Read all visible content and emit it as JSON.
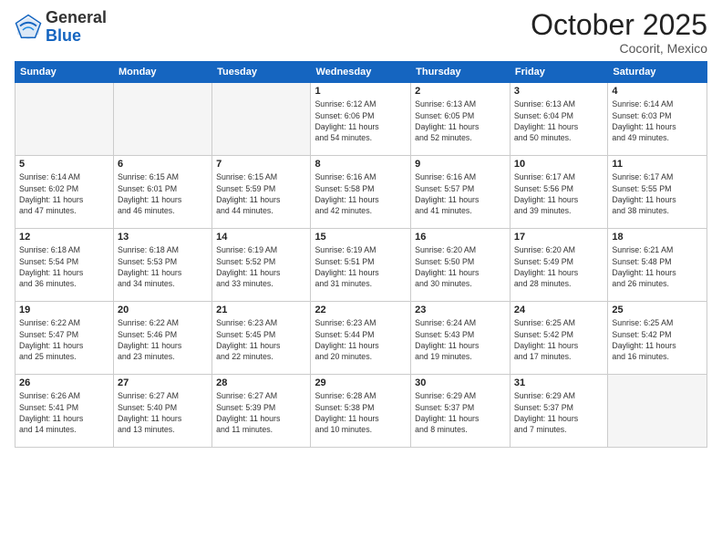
{
  "logo": {
    "general": "General",
    "blue": "Blue"
  },
  "header": {
    "month": "October 2025",
    "location": "Cocorit, Mexico"
  },
  "weekdays": [
    "Sunday",
    "Monday",
    "Tuesday",
    "Wednesday",
    "Thursday",
    "Friday",
    "Saturday"
  ],
  "weeks": [
    [
      {
        "day": "",
        "info": ""
      },
      {
        "day": "",
        "info": ""
      },
      {
        "day": "",
        "info": ""
      },
      {
        "day": "1",
        "info": "Sunrise: 6:12 AM\nSunset: 6:06 PM\nDaylight: 11 hours\nand 54 minutes."
      },
      {
        "day": "2",
        "info": "Sunrise: 6:13 AM\nSunset: 6:05 PM\nDaylight: 11 hours\nand 52 minutes."
      },
      {
        "day": "3",
        "info": "Sunrise: 6:13 AM\nSunset: 6:04 PM\nDaylight: 11 hours\nand 50 minutes."
      },
      {
        "day": "4",
        "info": "Sunrise: 6:14 AM\nSunset: 6:03 PM\nDaylight: 11 hours\nand 49 minutes."
      }
    ],
    [
      {
        "day": "5",
        "info": "Sunrise: 6:14 AM\nSunset: 6:02 PM\nDaylight: 11 hours\nand 47 minutes."
      },
      {
        "day": "6",
        "info": "Sunrise: 6:15 AM\nSunset: 6:01 PM\nDaylight: 11 hours\nand 46 minutes."
      },
      {
        "day": "7",
        "info": "Sunrise: 6:15 AM\nSunset: 5:59 PM\nDaylight: 11 hours\nand 44 minutes."
      },
      {
        "day": "8",
        "info": "Sunrise: 6:16 AM\nSunset: 5:58 PM\nDaylight: 11 hours\nand 42 minutes."
      },
      {
        "day": "9",
        "info": "Sunrise: 6:16 AM\nSunset: 5:57 PM\nDaylight: 11 hours\nand 41 minutes."
      },
      {
        "day": "10",
        "info": "Sunrise: 6:17 AM\nSunset: 5:56 PM\nDaylight: 11 hours\nand 39 minutes."
      },
      {
        "day": "11",
        "info": "Sunrise: 6:17 AM\nSunset: 5:55 PM\nDaylight: 11 hours\nand 38 minutes."
      }
    ],
    [
      {
        "day": "12",
        "info": "Sunrise: 6:18 AM\nSunset: 5:54 PM\nDaylight: 11 hours\nand 36 minutes."
      },
      {
        "day": "13",
        "info": "Sunrise: 6:18 AM\nSunset: 5:53 PM\nDaylight: 11 hours\nand 34 minutes."
      },
      {
        "day": "14",
        "info": "Sunrise: 6:19 AM\nSunset: 5:52 PM\nDaylight: 11 hours\nand 33 minutes."
      },
      {
        "day": "15",
        "info": "Sunrise: 6:19 AM\nSunset: 5:51 PM\nDaylight: 11 hours\nand 31 minutes."
      },
      {
        "day": "16",
        "info": "Sunrise: 6:20 AM\nSunset: 5:50 PM\nDaylight: 11 hours\nand 30 minutes."
      },
      {
        "day": "17",
        "info": "Sunrise: 6:20 AM\nSunset: 5:49 PM\nDaylight: 11 hours\nand 28 minutes."
      },
      {
        "day": "18",
        "info": "Sunrise: 6:21 AM\nSunset: 5:48 PM\nDaylight: 11 hours\nand 26 minutes."
      }
    ],
    [
      {
        "day": "19",
        "info": "Sunrise: 6:22 AM\nSunset: 5:47 PM\nDaylight: 11 hours\nand 25 minutes."
      },
      {
        "day": "20",
        "info": "Sunrise: 6:22 AM\nSunset: 5:46 PM\nDaylight: 11 hours\nand 23 minutes."
      },
      {
        "day": "21",
        "info": "Sunrise: 6:23 AM\nSunset: 5:45 PM\nDaylight: 11 hours\nand 22 minutes."
      },
      {
        "day": "22",
        "info": "Sunrise: 6:23 AM\nSunset: 5:44 PM\nDaylight: 11 hours\nand 20 minutes."
      },
      {
        "day": "23",
        "info": "Sunrise: 6:24 AM\nSunset: 5:43 PM\nDaylight: 11 hours\nand 19 minutes."
      },
      {
        "day": "24",
        "info": "Sunrise: 6:25 AM\nSunset: 5:42 PM\nDaylight: 11 hours\nand 17 minutes."
      },
      {
        "day": "25",
        "info": "Sunrise: 6:25 AM\nSunset: 5:42 PM\nDaylight: 11 hours\nand 16 minutes."
      }
    ],
    [
      {
        "day": "26",
        "info": "Sunrise: 6:26 AM\nSunset: 5:41 PM\nDaylight: 11 hours\nand 14 minutes."
      },
      {
        "day": "27",
        "info": "Sunrise: 6:27 AM\nSunset: 5:40 PM\nDaylight: 11 hours\nand 13 minutes."
      },
      {
        "day": "28",
        "info": "Sunrise: 6:27 AM\nSunset: 5:39 PM\nDaylight: 11 hours\nand 11 minutes."
      },
      {
        "day": "29",
        "info": "Sunrise: 6:28 AM\nSunset: 5:38 PM\nDaylight: 11 hours\nand 10 minutes."
      },
      {
        "day": "30",
        "info": "Sunrise: 6:29 AM\nSunset: 5:37 PM\nDaylight: 11 hours\nand 8 minutes."
      },
      {
        "day": "31",
        "info": "Sunrise: 6:29 AM\nSunset: 5:37 PM\nDaylight: 11 hours\nand 7 minutes."
      },
      {
        "day": "",
        "info": ""
      }
    ]
  ]
}
